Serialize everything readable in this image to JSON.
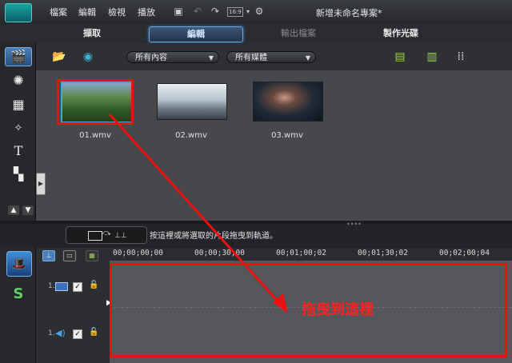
{
  "menu": {
    "items": [
      "檔案",
      "編輯",
      "檢視",
      "播放"
    ],
    "window_title": "新增未命名專案*",
    "aspect_ratio": "16:9"
  },
  "tabs": [
    {
      "label": "擷取",
      "state": "normal"
    },
    {
      "label": "編輯",
      "state": "active"
    },
    {
      "label": "輸出檔案",
      "state": "disabled"
    },
    {
      "label": "製作光碟",
      "state": "normal"
    }
  ],
  "library": {
    "filter_content": "所有內容",
    "filter_media": "所有媒體",
    "clips": [
      {
        "name": "01.wmv",
        "selected": true
      },
      {
        "name": "02.wmv",
        "selected": false
      },
      {
        "name": "03.wmv",
        "selected": false
      }
    ]
  },
  "timeline": {
    "hint": "按這裡或將選取的片段拖曳到軌道。",
    "ruler": [
      "00;00;00;00",
      "00;00;30;00",
      "00;01;00;02",
      "00;01;30;02",
      "00;02;00;04"
    ],
    "tracks": [
      {
        "number": "1.",
        "kind": "video",
        "icon": "film-strip-icon",
        "enabled": true,
        "locked": false
      },
      {
        "number": "1.",
        "kind": "audio",
        "icon": "speaker-icon",
        "enabled": true,
        "locked": false
      }
    ]
  },
  "annotation": {
    "text": "拖曳到這裡",
    "color": "#ff2020"
  },
  "colors": {
    "accent": "#6aa6e0",
    "highlight": "#ee1010",
    "library_bg": "#46484c"
  }
}
